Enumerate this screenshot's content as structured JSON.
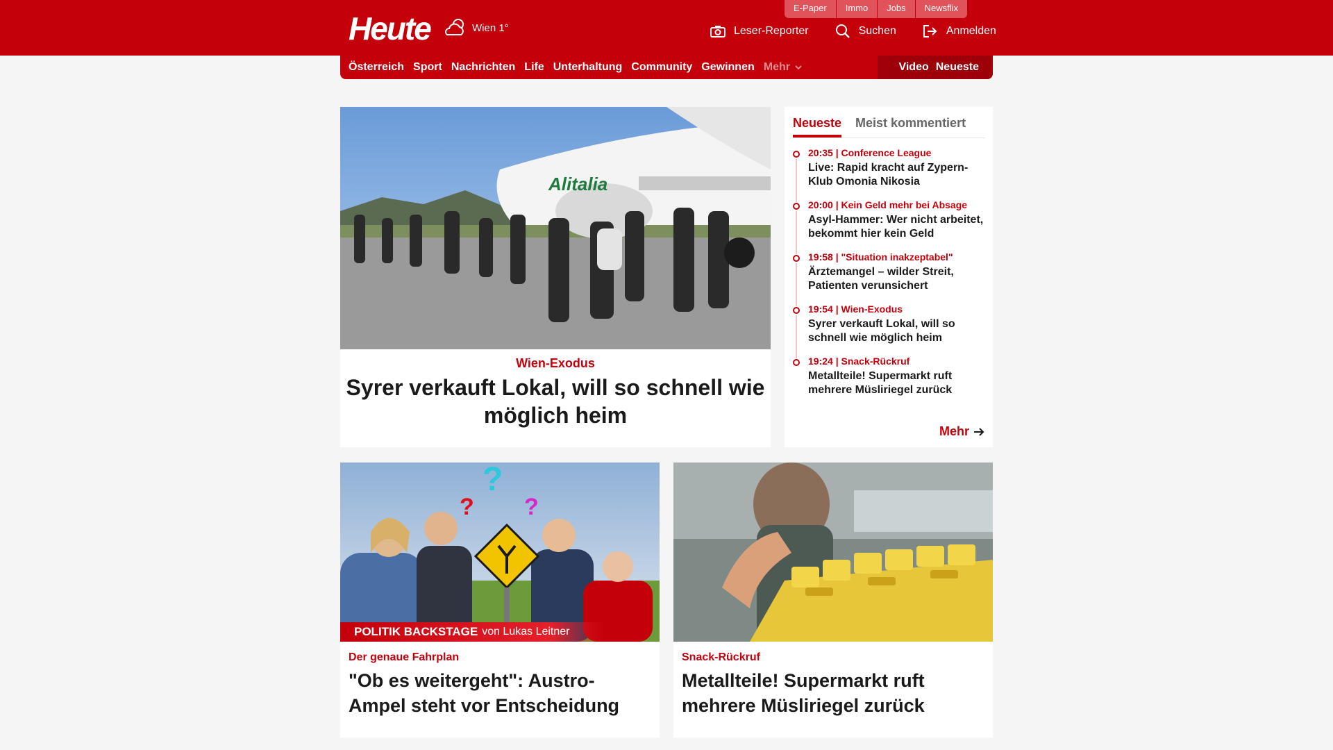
{
  "header": {
    "logo": "Heute",
    "weather": {
      "icon": "cloud-icon",
      "label": "Wien 1°"
    },
    "subnav": [
      "E-Paper",
      "Immo",
      "Jobs",
      "Newsflix"
    ],
    "actions": [
      {
        "label": "Leser-Reporter",
        "icon": "camera-icon"
      },
      {
        "label": "Suchen",
        "icon": "search-icon"
      },
      {
        "label": "Anmelden",
        "icon": "login-icon"
      }
    ]
  },
  "nav": {
    "items": [
      "Österreich",
      "Sport",
      "Nachrichten",
      "Life",
      "Unterhaltung",
      "Community",
      "Gewinnen"
    ],
    "more": "Mehr",
    "right": [
      "Video",
      "Neueste"
    ]
  },
  "hero": {
    "kicker": "Wien-Exodus",
    "title": "Syrer verkauft Lokal, will so schnell wie möglich heim"
  },
  "sidebar": {
    "tabs": [
      "Neueste",
      "Meist kommentiert"
    ],
    "items": [
      {
        "meta": "20:35 | Conference League",
        "title": "Live: Rapid kracht auf Zypern-Klub Omonia Nikosia"
      },
      {
        "meta": "20:00 | Kein Geld mehr bei Absage",
        "title": "Asyl-Hammer: Wer nicht arbeitet, bekommt hier kein Geld"
      },
      {
        "meta": "19:58 | \"Situation inakzeptabel\"",
        "title": "Ärztemangel – wilder Streit, Patienten verunsichert"
      },
      {
        "meta": "19:54 | Wien-Exodus",
        "title": "Syrer verkauft Lokal, will so schnell wie möglich heim"
      },
      {
        "meta": "19:24 | Snack-Rückruf",
        "title": "Metallteile! Supermarkt ruft mehrere Müsliriegel zurück"
      }
    ],
    "more": "Mehr"
  },
  "cards": [
    {
      "banner_main": "POLITIK BACKSTAGE",
      "banner_sub": "von Lukas Leitner",
      "kicker": "Der genaue Fahrplan",
      "title": "\"Ob es weitergeht\": Austro-Ampel steht vor Entscheidung"
    },
    {
      "kicker": "Snack-Rückruf",
      "title": "Metallteile! Supermarkt ruft mehrere Müsliriegel zurück"
    }
  ],
  "colors": {
    "brand": "#c4000b",
    "background": "#f5f5f5"
  }
}
